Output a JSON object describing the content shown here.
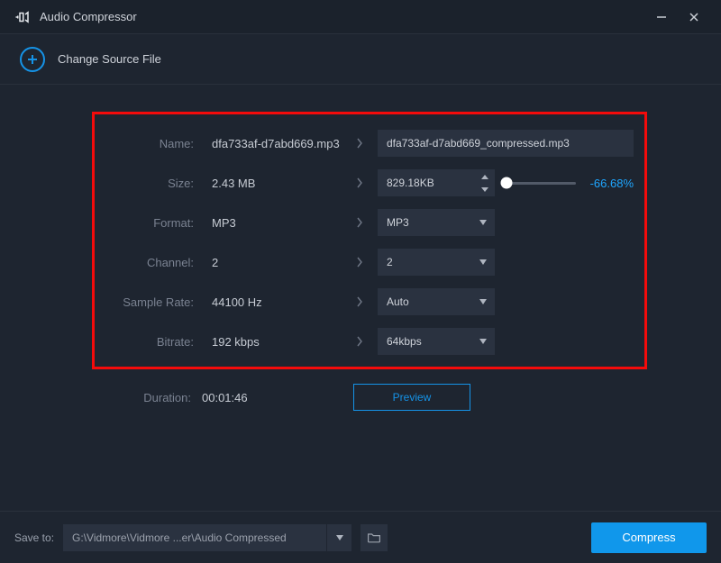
{
  "titlebar": {
    "title": "Audio Compressor"
  },
  "source": {
    "change_label": "Change Source File"
  },
  "rows": {
    "name": {
      "label": "Name:",
      "src": "dfa733af-d7abd669.mp3",
      "dest": "dfa733af-d7abd669_compressed.mp3"
    },
    "size": {
      "label": "Size:",
      "src": "2.43 MB",
      "dest": "829.18KB",
      "pct": "-66.68%"
    },
    "format": {
      "label": "Format:",
      "src": "MP3",
      "dest": "MP3"
    },
    "channel": {
      "label": "Channel:",
      "src": "2",
      "dest": "2"
    },
    "srate": {
      "label": "Sample Rate:",
      "src": "44100 Hz",
      "dest": "Auto"
    },
    "bitrate": {
      "label": "Bitrate:",
      "src": "192 kbps",
      "dest": "64kbps"
    },
    "duration": {
      "label": "Duration:",
      "src": "00:01:46"
    }
  },
  "preview": {
    "label": "Preview"
  },
  "footer": {
    "saveto_label": "Save to:",
    "path": "G:\\Vidmore\\Vidmore ...er\\Audio Compressed",
    "compress_label": "Compress"
  }
}
